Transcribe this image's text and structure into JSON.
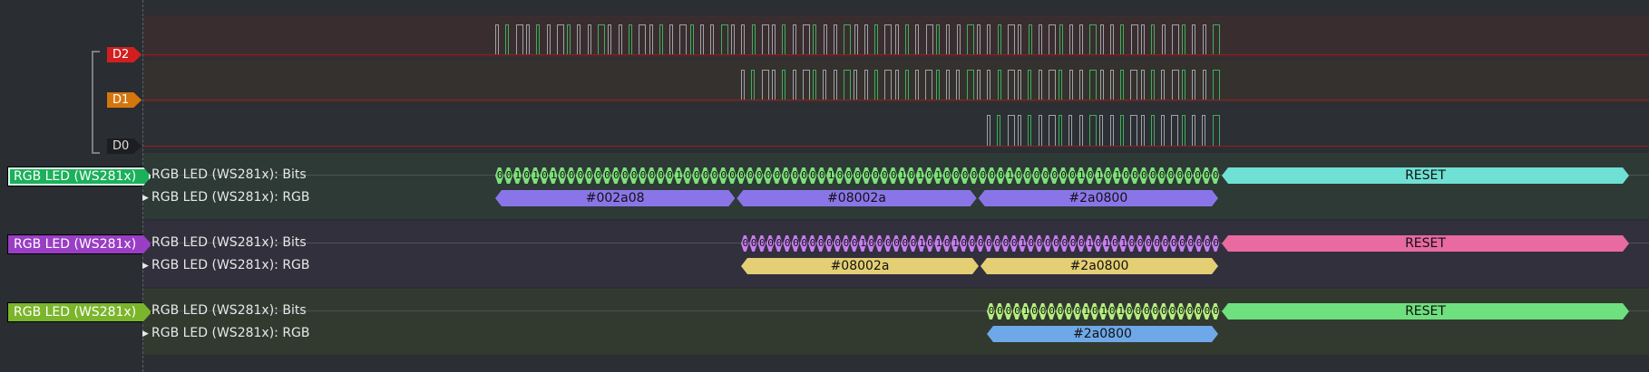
{
  "channels": [
    {
      "label": "D2",
      "color": "#d11f1f"
    },
    {
      "label": "D1",
      "color": "#d4760e"
    },
    {
      "label": "D0",
      "color": "#1c1e21"
    }
  ],
  "decoders": [
    {
      "tag": "RGB LED (WS281x)",
      "tag_color": "#1bb15a",
      "bits_label": "RGB LED (WS281x): Bits",
      "rgb_label": "RGB LED (WS281x): RGB",
      "bit_color": "#7ee07a",
      "bits": "001010100000000000001000000000000000010000000101010000000100000001010100000000000",
      "rgb_color": "#8a75e8",
      "rgb_values": [
        "#002a08",
        "#08002a",
        "#2a0800"
      ],
      "reset_label": "RESET",
      "reset_color": "#6fe0d4"
    },
    {
      "tag": "RGB LED (WS281x)",
      "tag_color": "#9a3ec5",
      "bits_label": "RGB LED (WS281x): Bits",
      "rgb_label": "RGB LED (WS281x): RGB",
      "bit_color": "#c77ef0",
      "bits": "000000000000001000000101010000000100000001010100000000000",
      "rgb_color": "#e5cf74",
      "rgb_values": [
        "#08002a",
        "#2a0800"
      ],
      "reset_label": "RESET",
      "reset_color": "#e86aa0"
    },
    {
      "tag": "RGB LED (WS281x)",
      "tag_color": "#7bb52c",
      "bits_label": "RGB LED (WS281x): Bits",
      "rgb_label": "RGB LED (WS281x): RGB",
      "bit_color": "#b4ef7e",
      "bits": "000010000001010100000000000",
      "rgb_color": "#6fa8e8",
      "rgb_values": [
        "#2a0800"
      ],
      "reset_label": "RESET",
      "reset_color": "#6ee07e"
    }
  ]
}
